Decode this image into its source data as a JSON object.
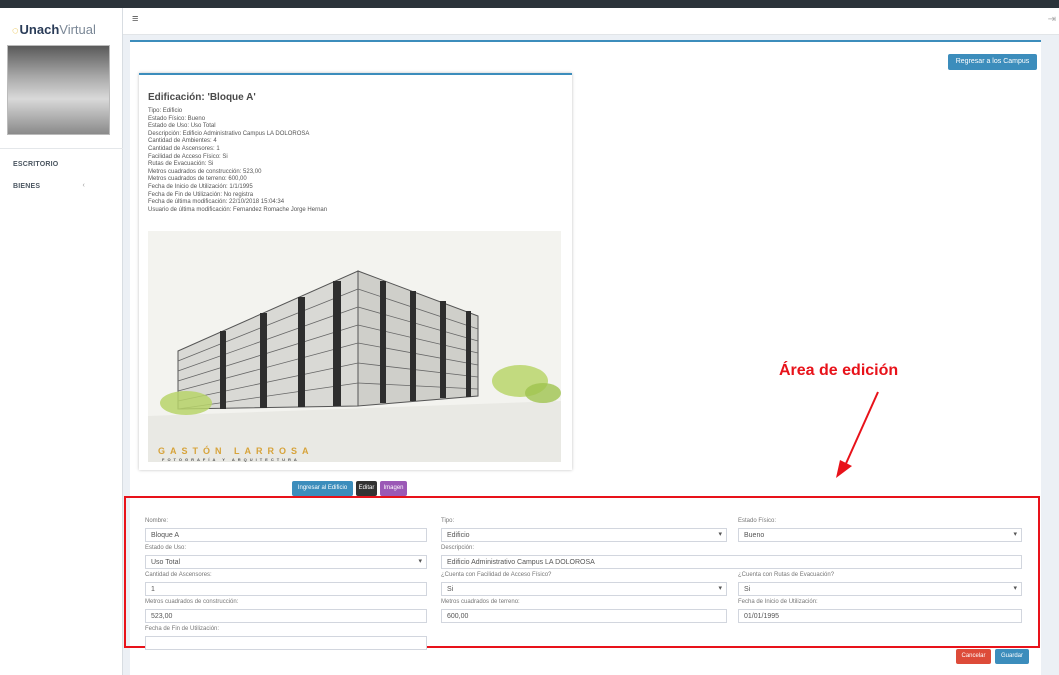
{
  "app": {
    "logo_bold": "Unach",
    "logo_light": "Virtual"
  },
  "sidebar": {
    "items": [
      {
        "label": "ESCRITORIO"
      },
      {
        "label": "BIENES"
      }
    ]
  },
  "header": {
    "menu_icon": "hamburger-icon"
  },
  "toolbar": {
    "back_label": "Regresar a los Campus"
  },
  "card": {
    "title_prefix": "Edificación: ",
    "title_name": "'Bloque A'",
    "details": [
      "Tipo: Edificio",
      "Estado Físico: Bueno",
      "Estado de Uso: Uso Total",
      "Descripción: Edificio Administrativo Campus LA DOLOROSA",
      "Cantidad de Ambientes: 4",
      "Cantidad de Ascensores: 1",
      "Facilidad de Acceso Físico: Si",
      "Rutas de Evacuación: Si",
      "Metros cuadrados de construcción: 523,00",
      "Metros cuadrados de terreno: 600,00",
      "Fecha de Inicio de Utilización: 1/1/1995",
      "Fecha de Fin de Utilización: No registra",
      "Fecha de última modificación: 22/10/2018 15:04:34",
      "Usuario de última modificación: Fernandez Romache Jorge Hernan"
    ],
    "photo_text_1": "GASTÓN LARROSA",
    "photo_text_2": "FOTOGRAFÍA Y ARQUITECTURA"
  },
  "card_buttons": {
    "ingresar": "Ingresar al Edificio",
    "editar": "Editar",
    "imagen": "Imagen"
  },
  "annotation": {
    "text": "Área de edición",
    "color": "#e8121a"
  },
  "form": {
    "nombre": {
      "label": "Nombre:",
      "value": "Bloque A"
    },
    "tipo": {
      "label": "Tipo:",
      "value": "Edificio"
    },
    "estado_fisico": {
      "label": "Estado Físico:",
      "value": "Bueno"
    },
    "estado_uso": {
      "label": "Estado de Uso:",
      "value": "Uso Total"
    },
    "descripcion": {
      "label": "Descripción:",
      "value": "Edificio Administrativo Campus LA DOLOROSA"
    },
    "ascensores": {
      "label": "Cantidad de Ascensores:",
      "value": "1"
    },
    "acceso": {
      "label": "¿Cuenta con Facilidad de Acceso Físico?",
      "value": "Si"
    },
    "rutas": {
      "label": "¿Cuenta con Rutas de Evacuación?",
      "value": "Si"
    },
    "m2_construccion": {
      "label": "Metros cuadrados de construcción:",
      "value": "523,00"
    },
    "m2_terreno": {
      "label": "Metros cuadrados de terreno:",
      "value": "600,00"
    },
    "fecha_inicio": {
      "label": "Fecha de Inicio de Utilización:",
      "value": "01/01/1995"
    },
    "fecha_fin": {
      "label": "Fecha de Fin de Utilización:",
      "value": ""
    },
    "cancel_label": "Cancelar",
    "save_label": "Guardar"
  },
  "colors": {
    "primary": "#3c8dbc",
    "danger": "#dd4b39",
    "purple": "#9b59b6",
    "dark": "#333333"
  }
}
